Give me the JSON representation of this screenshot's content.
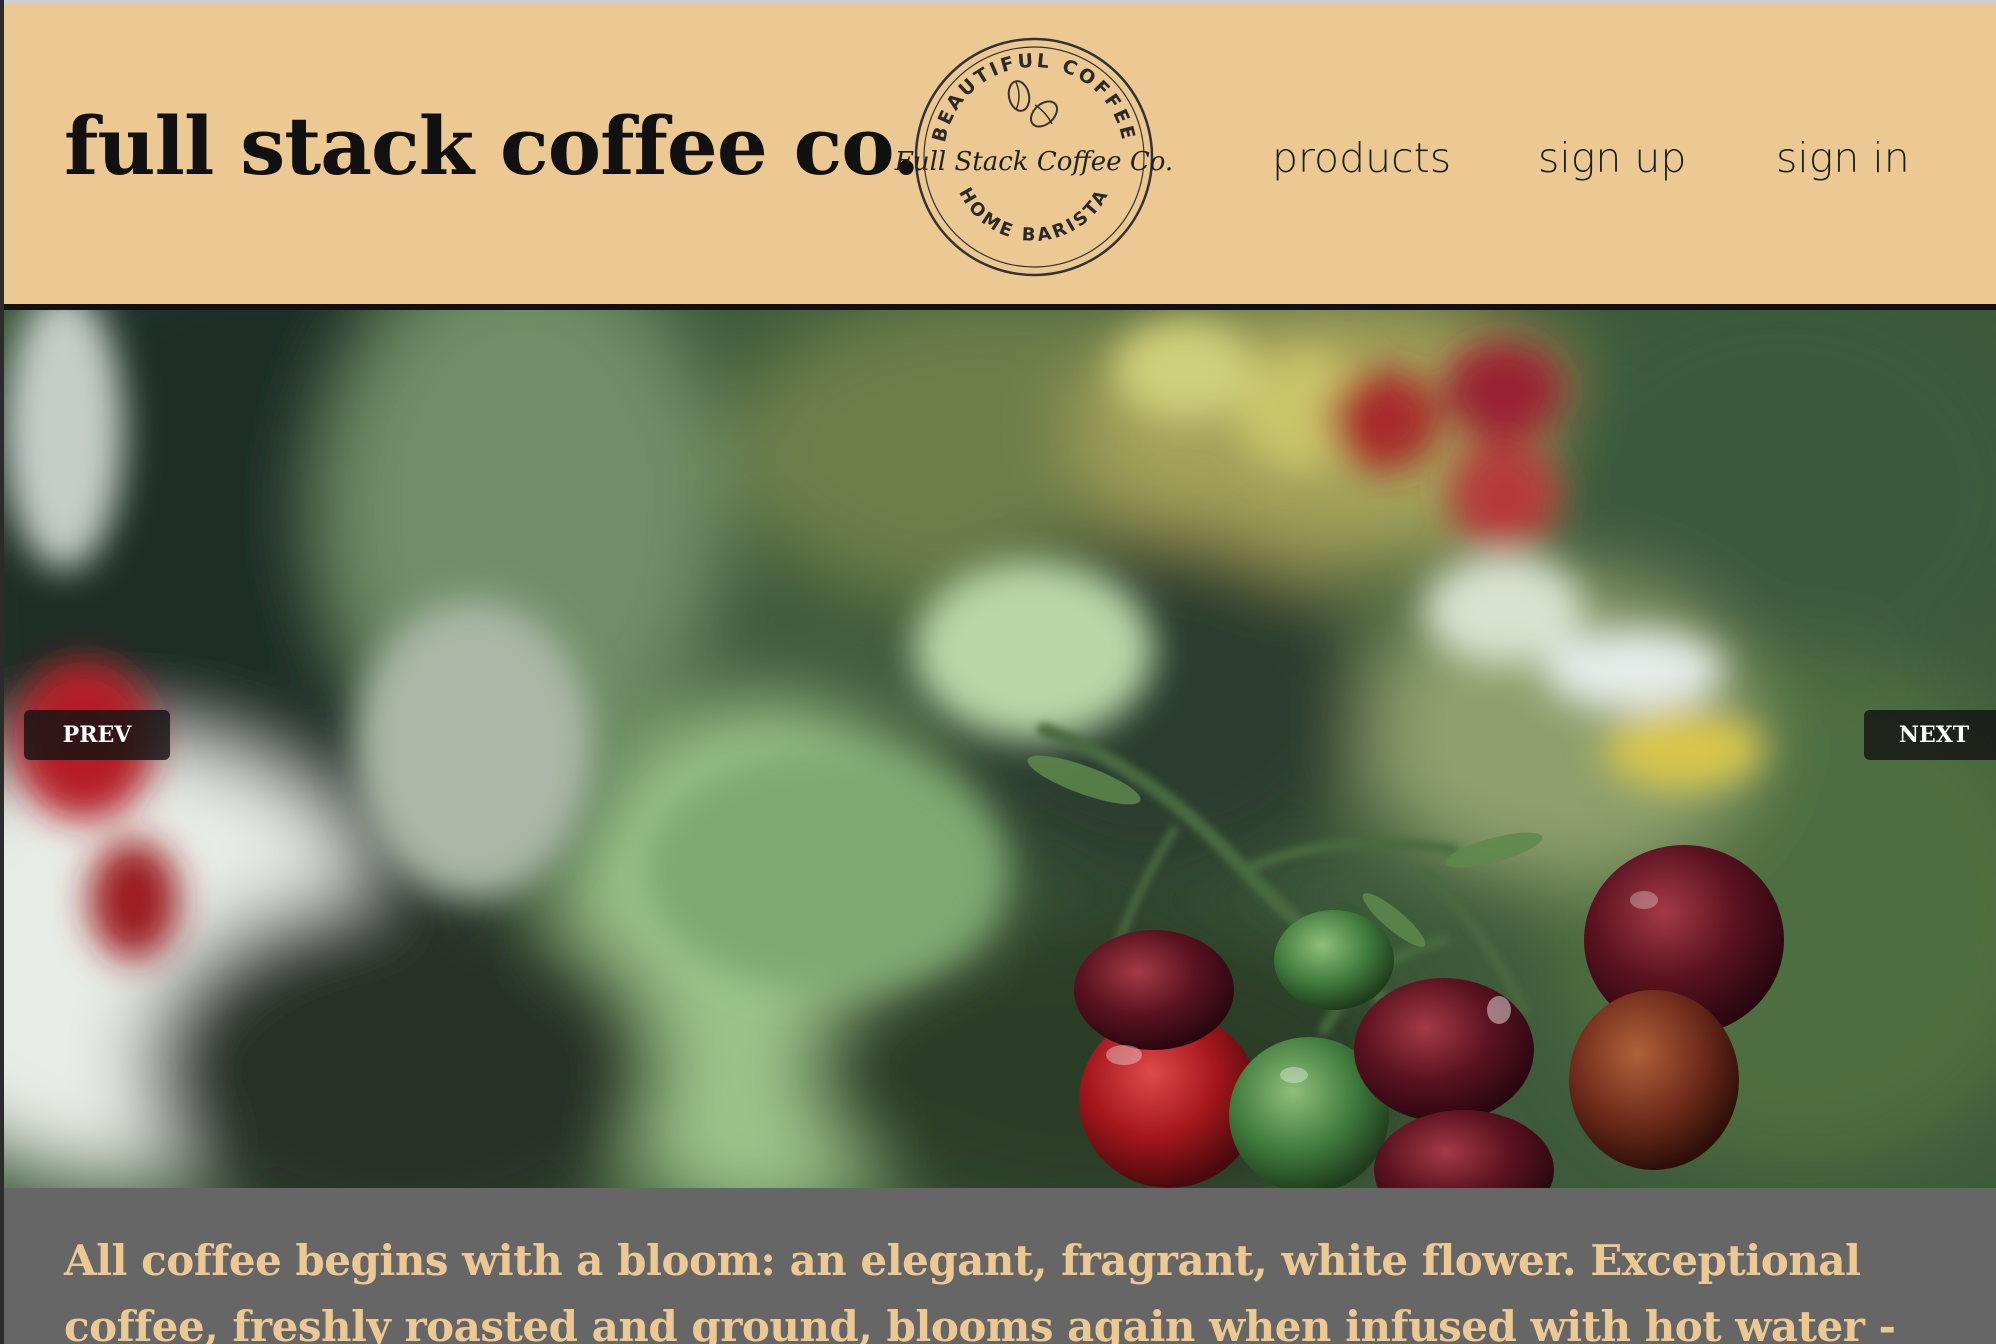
{
  "header": {
    "brand": "full stack coffee co.",
    "nav": {
      "products": "products",
      "sign_up": "sign up",
      "sign_in": "sign in"
    },
    "logo": {
      "top_arc": "BEAUTIFUL COFFEE",
      "center": "Full Stack Coffee Co.",
      "bottom_arc": "HOME BARISTA"
    }
  },
  "hero": {
    "prev_label": "PREV",
    "next_label": "NEXT"
  },
  "intro": {
    "text": "All coffee begins with a bloom: an elegant, fragrant, white flower. Exceptional coffee, freshly roasted and ground, blooms again when infused with hot water -"
  },
  "colors": {
    "header_bg": "#ecc892",
    "intro_bg": "#666666",
    "intro_text": "#ecc892"
  }
}
